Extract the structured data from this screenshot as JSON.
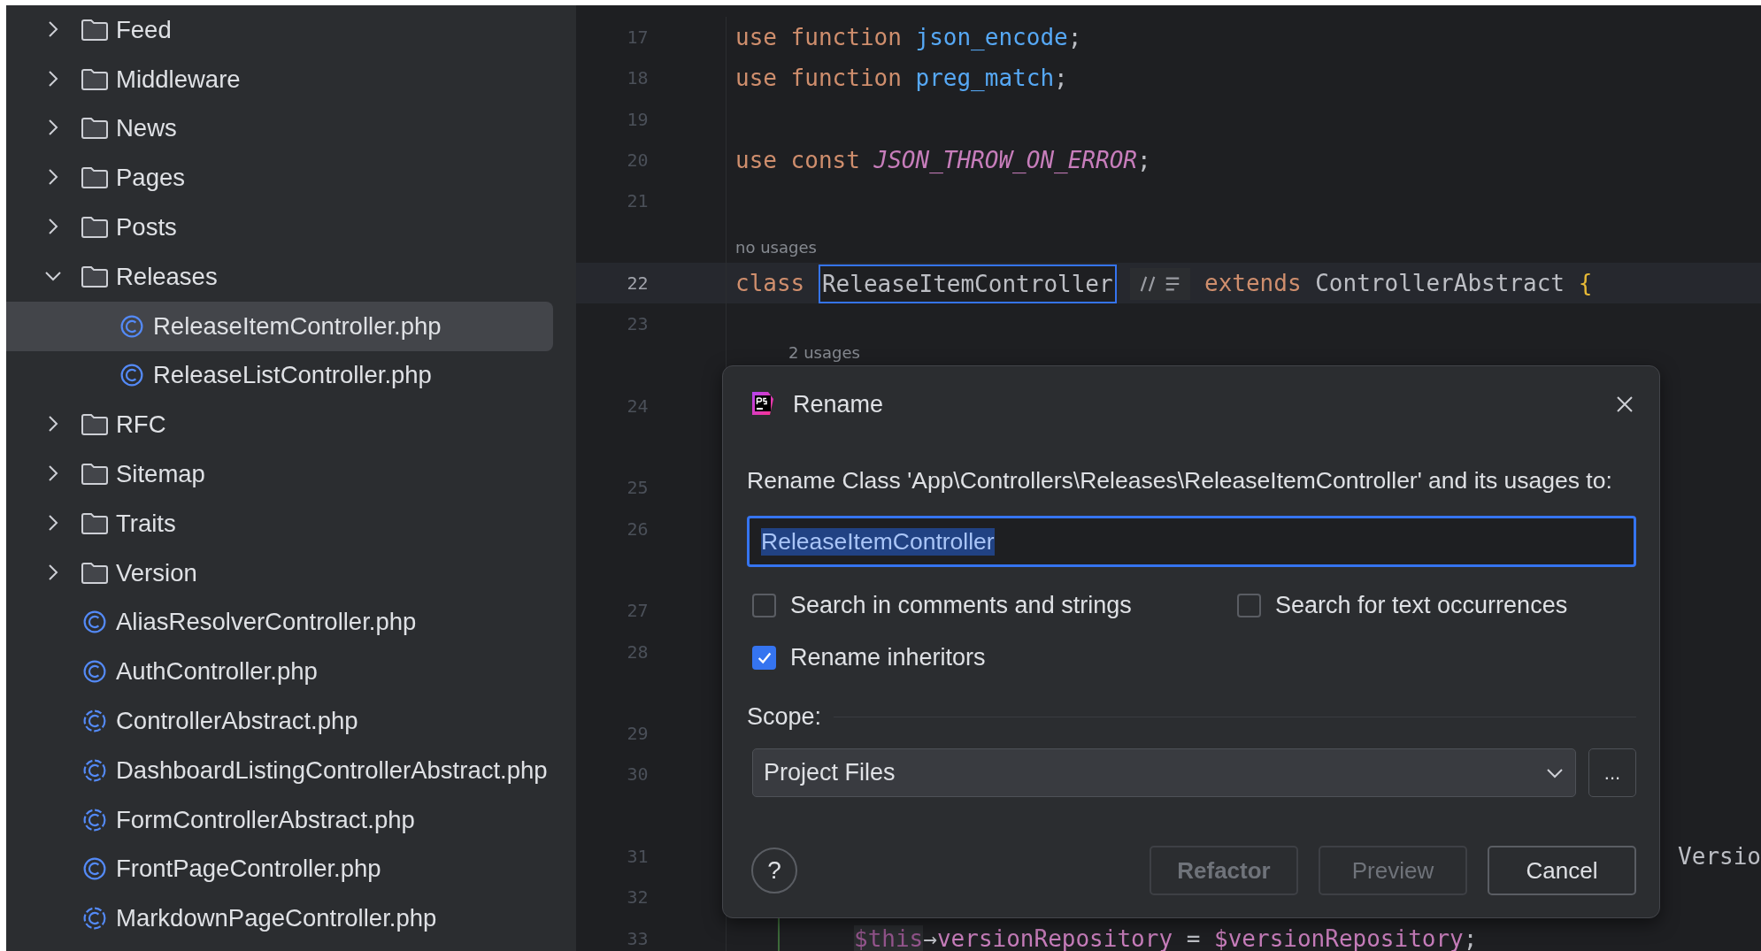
{
  "project_tree": [
    {
      "kind": "folder",
      "label": "Feed",
      "expanded": false,
      "selected": false
    },
    {
      "kind": "folder",
      "label": "Middleware",
      "expanded": false,
      "selected": false
    },
    {
      "kind": "folder",
      "label": "News",
      "expanded": false,
      "selected": false
    },
    {
      "kind": "folder",
      "label": "Pages",
      "expanded": false,
      "selected": false
    },
    {
      "kind": "folder",
      "label": "Posts",
      "expanded": false,
      "selected": false
    },
    {
      "kind": "folder",
      "label": "Releases",
      "expanded": true,
      "selected": false,
      "children": [
        {
          "kind": "class",
          "label": "ReleaseItemController.php",
          "selected": true
        },
        {
          "kind": "class",
          "label": "ReleaseListController.php",
          "selected": false
        }
      ]
    },
    {
      "kind": "folder",
      "label": "RFC",
      "expanded": false,
      "selected": false
    },
    {
      "kind": "folder",
      "label": "Sitemap",
      "expanded": false,
      "selected": false
    },
    {
      "kind": "folder",
      "label": "Traits",
      "expanded": false,
      "selected": false
    },
    {
      "kind": "folder",
      "label": "Version",
      "expanded": false,
      "selected": false
    },
    {
      "kind": "class",
      "label": "AliasResolverController.php",
      "selected": false
    },
    {
      "kind": "class",
      "label": "AuthController.php",
      "selected": false
    },
    {
      "kind": "abstract",
      "label": "ControllerAbstract.php",
      "selected": false
    },
    {
      "kind": "abstract",
      "label": "DashboardListingControllerAbstract.php",
      "selected": false
    },
    {
      "kind": "abstract",
      "label": "FormControllerAbstract.php",
      "selected": false
    },
    {
      "kind": "class",
      "label": "FrontPageController.php",
      "selected": false
    },
    {
      "kind": "abstract",
      "label": "MarkdownPageController.php",
      "selected": false
    }
  ],
  "editor": {
    "lines": [
      {
        "kind": "code",
        "number": "17",
        "tokens": [
          {
            "kind": "keyword",
            "text": "use function"
          },
          {
            "kind": "function",
            "text": "json_encode"
          },
          {
            "kind": "punct",
            "text": ";"
          }
        ]
      },
      {
        "kind": "code",
        "number": "18",
        "tokens": [
          {
            "kind": "keyword",
            "text": "use function"
          },
          {
            "kind": "function",
            "text": "preg_match"
          },
          {
            "kind": "punct",
            "text": ";"
          }
        ]
      },
      {
        "kind": "code",
        "number": "19"
      },
      {
        "kind": "code",
        "number": "20",
        "tokens": [
          {
            "kind": "keyword",
            "text": "use const"
          },
          {
            "kind": "constant",
            "text": "JSON_THROW_ON_ERROR"
          },
          {
            "kind": "punct",
            "text": ";"
          }
        ]
      },
      {
        "kind": "code",
        "number": "21"
      },
      {
        "kind": "hint",
        "text": "no usages"
      },
      {
        "kind": "current",
        "number": "22",
        "tokens": [
          {
            "kind": "keyword",
            "text": "class"
          },
          {
            "kind": "renamed",
            "text": "ReleaseItemController"
          },
          {
            "kind": "inlay"
          },
          {
            "kind": "keyword",
            "text": "extends"
          },
          {
            "kind": "plain",
            "text": "ControllerAbstract"
          },
          {
            "kind": "brace",
            "text": "{"
          }
        ]
      },
      {
        "kind": "code",
        "number": "23"
      },
      {
        "kind": "member-hint",
        "text": "2 usages"
      },
      {
        "kind": "code",
        "number": "24"
      },
      {
        "kind": "hint"
      },
      {
        "kind": "code",
        "number": "25"
      },
      {
        "kind": "code",
        "number": "26"
      },
      {
        "kind": "hint"
      },
      {
        "kind": "code",
        "number": "27"
      },
      {
        "kind": "code",
        "number": "28"
      },
      {
        "kind": "hint"
      },
      {
        "kind": "code",
        "number": "29"
      },
      {
        "kind": "code",
        "number": "30"
      },
      {
        "kind": "hint"
      },
      {
        "kind": "code",
        "number": "31",
        "tokens": [
          {
            "kind": "tail",
            "text": "Versio"
          }
        ]
      },
      {
        "kind": "code",
        "number": "32"
      },
      {
        "kind": "indented",
        "number": "33",
        "tokens": [
          {
            "kind": "this",
            "text": "$this"
          },
          {
            "kind": "punct",
            "text": "→"
          },
          {
            "kind": "member",
            "text": "versionRepository"
          },
          {
            "kind": "plain",
            "text": "="
          },
          {
            "kind": "variable",
            "text": "$versionRepository"
          },
          {
            "kind": "punct",
            "text": ";"
          }
        ]
      }
    ]
  },
  "rename_dialog": {
    "title": "Rename",
    "description": "Rename Class 'App\\Controllers\\Releases\\ReleaseItemController' and its usages to:",
    "new_name": "ReleaseItemController",
    "text_selected": true,
    "options": [
      {
        "label": "Search in comments and strings",
        "checked": false
      },
      {
        "label": "Search for text occurrences",
        "checked": false
      },
      {
        "label": "Rename inheritors",
        "checked": true
      }
    ],
    "scope": {
      "label": "Scope:",
      "value": "Project Files",
      "more_button": "..."
    },
    "help_button": "?",
    "buttons": [
      {
        "label": "Refactor",
        "disabled": true,
        "default": true
      },
      {
        "label": "Preview",
        "disabled": true,
        "default": false
      },
      {
        "label": "Cancel",
        "disabled": false,
        "default": false
      }
    ]
  }
}
